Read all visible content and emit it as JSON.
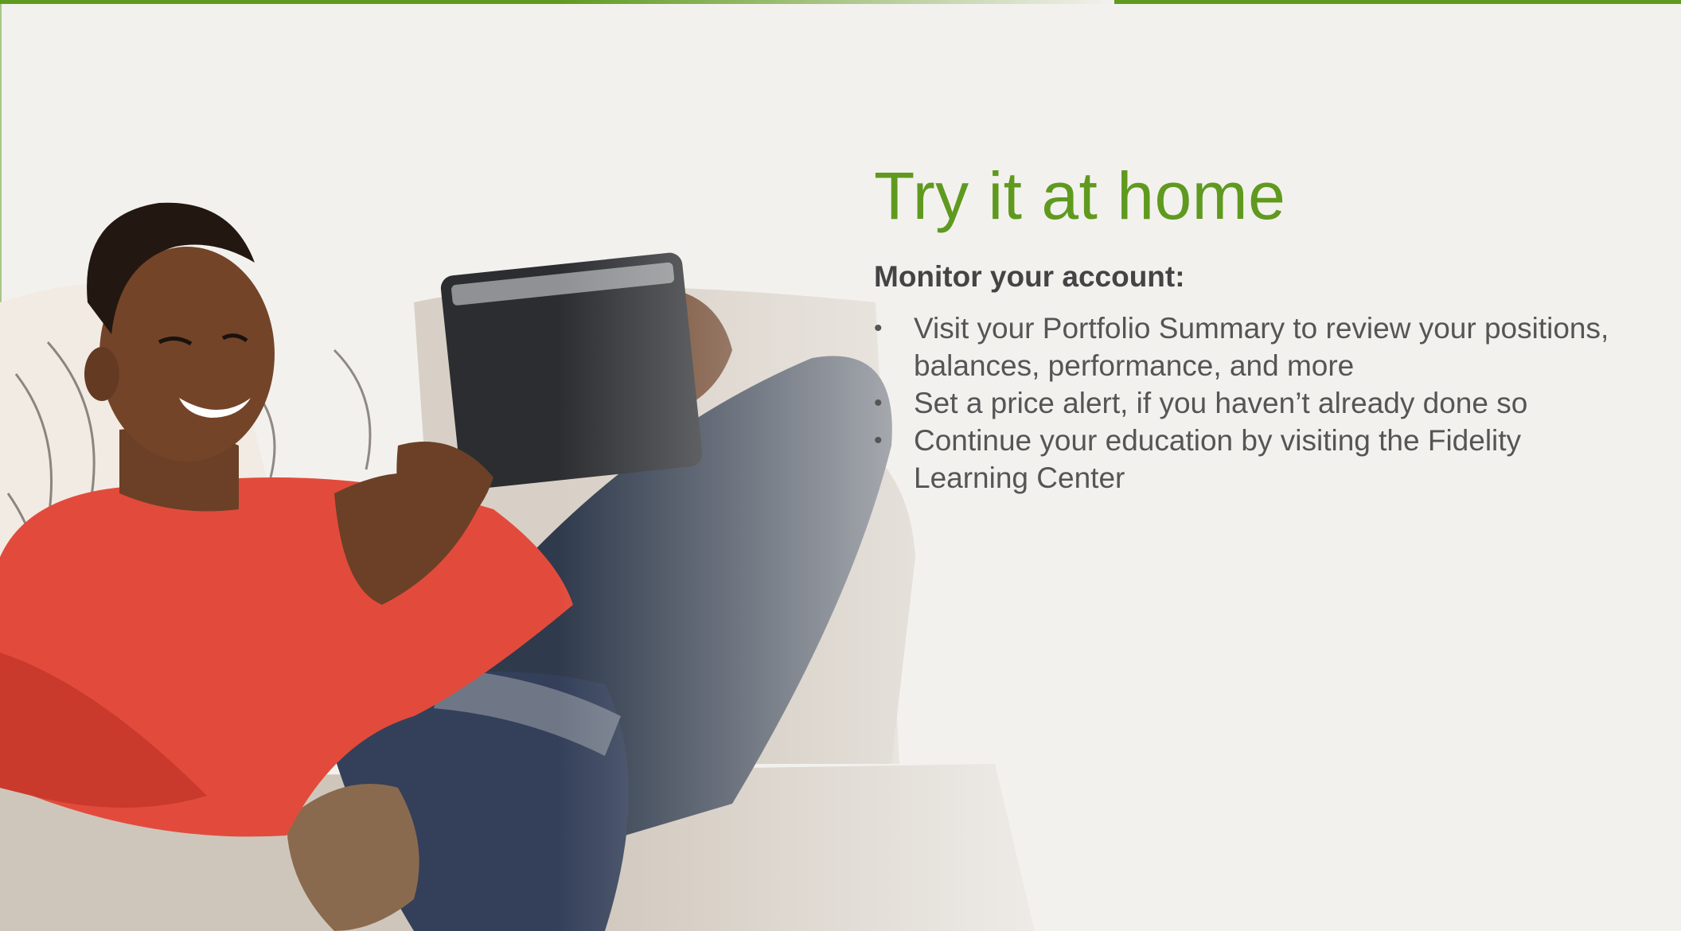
{
  "slide": {
    "title": "Try it at home",
    "subtitle": "Monitor your account:",
    "bullets": [
      "Visit your Portfolio Summary to review your positions, balances, performance, and more",
      "Set a price alert, if you haven’t already done so",
      "Continue your education by visiting the Fidelity Learning Center"
    ],
    "bullet_glyph": "•"
  },
  "colors": {
    "accent": "#5f9a1f",
    "background": "#f3f1ee",
    "subtitle_text": "#444444",
    "body_text": "#555555"
  }
}
